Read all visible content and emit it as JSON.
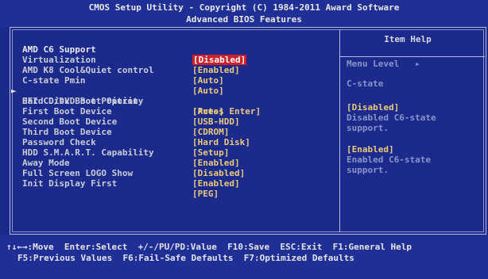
{
  "header": {
    "line1": "CMOS Setup Utility - Copyright (C) 1984-2011 Award Software",
    "line2": "Advanced BIOS Features"
  },
  "settings": [
    {
      "label": "AMD C6 Support",
      "value": "[Disabled]",
      "selected": true
    },
    {
      "label": "Virtualization",
      "value": "[Enabled]"
    },
    {
      "label": "AMD K8 Cool&Quiet control",
      "value": "[Auto]"
    },
    {
      "label": "C-state Pmin",
      "value": "[Auto]"
    },
    {
      "label": "Hard Disk Boot Priority",
      "value": "[Press Enter]",
      "submenu": true
    },
    {
      "label": "EFI CD/DVD Boot Option",
      "value": "[Auto]"
    },
    {
      "label": "First Boot Device",
      "value": "[USB-HDD]"
    },
    {
      "label": "Second Boot Device",
      "value": "[CDROM]"
    },
    {
      "label": "Third Boot Device",
      "value": "[Hard Disk]"
    },
    {
      "label": "Password Check",
      "value": "[Setup]"
    },
    {
      "label": "HDD S.M.A.R.T. Capability",
      "value": "[Enabled]"
    },
    {
      "label": "Away Mode",
      "value": "[Disabled]"
    },
    {
      "label": "Full Screen LOGO Show",
      "value": "[Enabled]"
    },
    {
      "label": "Init Display First",
      "value": "[PEG]"
    }
  ],
  "help": {
    "title": "Item Help",
    "menu_level": "Menu Level   ▸",
    "state_title": "C-state",
    "opt1_label": "[Disabled]",
    "opt1_line1": "Disabled C6-state",
    "opt1_line2": "support.",
    "opt2_label": "[Enabled]",
    "opt2_line1": "Enabled C6-state",
    "opt2_line2": "support."
  },
  "footer": {
    "line1": "↑↓←→:Move  Enter:Select  +/-/PU/PD:Value  F10:Save  ESC:Exit  F1:General Help",
    "line2": "F5:Previous Values  F6:Fail-Safe Defaults  F7:Optimized Defaults"
  },
  "colors": {
    "background": "#1c2a8c",
    "value_text": "#e9c97a",
    "selected_bg": "#d0202a"
  }
}
